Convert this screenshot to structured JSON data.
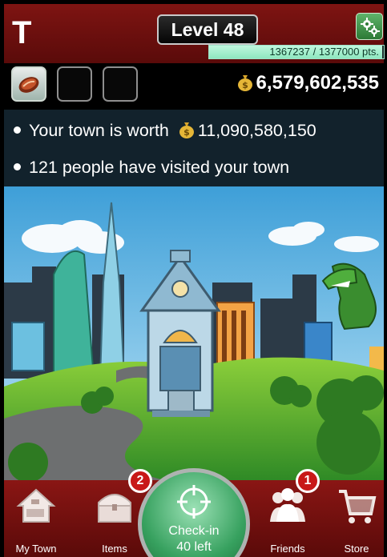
{
  "header": {
    "brand": "T",
    "level_label": "Level 48",
    "xp_text": "1367237 / 1377000 pts.",
    "xp_progress": 0.993,
    "settings_icon": "gear-icon"
  },
  "item_bar": {
    "slots": [
      {
        "icon": "meat-item-icon",
        "active": true
      },
      {
        "icon": "",
        "active": false
      },
      {
        "icon": "",
        "active": false
      }
    ],
    "money_icon": "money-bag-icon",
    "money": "6,579,602,535"
  },
  "info": {
    "worth_prefix": "Your town is worth",
    "worth_value": "11,090,580,150",
    "visitors": "121 people have visited your town"
  },
  "scene": {
    "description_icons": [
      "city-skyline",
      "clock-tower",
      "green-monster"
    ]
  },
  "nav": {
    "items": [
      {
        "label": "My Town",
        "icon": "house-icon"
      },
      {
        "label": "Items",
        "icon": "treasure-chest-icon",
        "badge": "2"
      },
      {
        "label": "Friends",
        "icon": "people-icon",
        "badge": "1"
      },
      {
        "label": "Store",
        "icon": "shopping-cart-icon"
      }
    ],
    "checkin": {
      "line1": "Check-in",
      "line2": "40 left",
      "icon": "crosshair-icon"
    }
  },
  "colors": {
    "header_red": "#7e1412",
    "xp_green": "#8ee7bf",
    "info_bg": "#12222c",
    "checkin_green": "#37a15f"
  }
}
